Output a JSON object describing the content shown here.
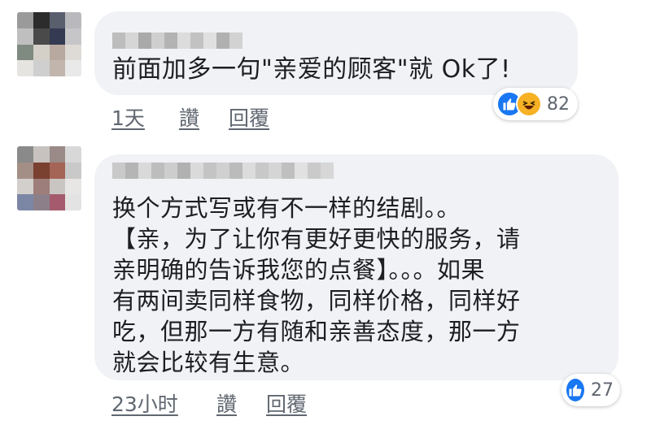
{
  "comments": [
    {
      "text": "前面加多一句\"亲爱的顾客\"就 Ok了!",
      "time": "1天",
      "like_label": "讚",
      "reply_label": "回覆",
      "reactions": [
        "like-icon",
        "haha-icon"
      ],
      "reaction_count": "82"
    },
    {
      "lines": [
        "换个方式写或有不一样的结剧。。",
        "【亲，为了让你有更好更快的服务，请",
        "亲明确的告诉我您的点餐】。。。如果",
        "有两间卖同样食物，同样价格，同样好",
        "吃，但那一方有随和亲善态度，那一方",
        "就会比较有生意。"
      ],
      "time": "23小时",
      "like_label": "讚",
      "reply_label": "回覆",
      "reactions": [
        "like-icon"
      ],
      "reaction_count": "27"
    }
  ],
  "colors": {
    "bubble": "#f0f2f5",
    "like_blue": "#1877f2",
    "haha_yellow": "#f7b125",
    "meta_gray": "#606770"
  }
}
